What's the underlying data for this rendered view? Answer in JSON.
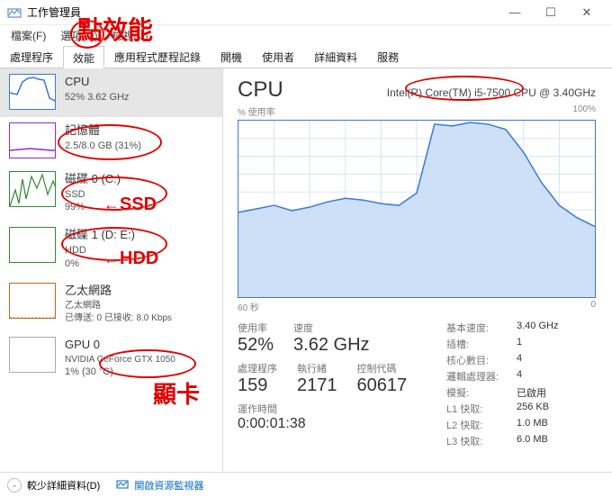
{
  "window": {
    "title": "工作管理員"
  },
  "menu": {
    "file": "檔案(F)",
    "options": "選項(O)",
    "view": "檢視(V)"
  },
  "tabs": [
    "處理程序",
    "效能",
    "應用程式歷程記錄",
    "開機",
    "使用者",
    "詳細資料",
    "服務"
  ],
  "sidebar": [
    {
      "name": "CPU",
      "sub": "52% 3.62 GHz",
      "color": "#3b78d6",
      "type": "cpu"
    },
    {
      "name": "記憶體",
      "sub": "2.5/8.0 GB (31%)",
      "color": "#8a2be2",
      "type": "mem"
    },
    {
      "name": "磁碟 0 (C:)",
      "sub1": "SSD",
      "sub2": "99%",
      "color": "#2e8b2e",
      "type": "disk"
    },
    {
      "name": "磁碟 1 (D: E:)",
      "sub1": "HDD",
      "sub2": "0%",
      "color": "#2e8b2e",
      "type": "disk"
    },
    {
      "name": "乙太網路",
      "sub1": "乙太網路",
      "sub2": "已傳送: 0  已接收: 8.0 Kbps",
      "color": "#b86b1f",
      "type": "net",
      "small": true
    },
    {
      "name": "GPU 0",
      "sub1": "NVIDIA GeForce GTX 1050",
      "sub2": "1% (30 °C)",
      "color": "#888",
      "type": "gpu"
    }
  ],
  "detail": {
    "title": "CPU",
    "model": "Intel(R) Core(TM) i5-7500 CPU @ 3.40GHz",
    "ylabel": "% 使用率",
    "ymax": "100%",
    "xleft": "60 秒",
    "xright": "0"
  },
  "stats_left": {
    "util_label": "使用率",
    "util": "52%",
    "speed_label": "速度",
    "speed": "3.62 GHz",
    "p_label": "處理程序",
    "p": "159",
    "t_label": "執行緒",
    "t": "2171",
    "h_label": "控制代碼",
    "h": "60617",
    "up_label": "運作時間",
    "up": "0:00:01:38"
  },
  "stats_right": [
    {
      "k": "基本速度:",
      "v": "3.40 GHz"
    },
    {
      "k": "插槽:",
      "v": "1"
    },
    {
      "k": "核心數目:",
      "v": "4"
    },
    {
      "k": "邏輯處理器:",
      "v": "4"
    },
    {
      "k": "模擬:",
      "v": "已啟用"
    },
    {
      "k": "L1 快取:",
      "v": "256 KB"
    },
    {
      "k": "L2 快取:",
      "v": "1.0 MB"
    },
    {
      "k": "L3 快取:",
      "v": "6.0 MB"
    }
  ],
  "bottom": {
    "less": "較少詳細資料(D)",
    "link": "開啟資源監視器"
  },
  "annotations": {
    "click_perf": "點效能",
    "ssd": "SSD",
    "hdd": "HDD",
    "gpu": "顯卡"
  },
  "chart_data": {
    "type": "area",
    "title": "CPU % 使用率",
    "xlabel": "秒",
    "ylabel": "% 使用率",
    "ylim": [
      0,
      100
    ],
    "x_seconds": [
      60,
      57,
      54,
      51,
      48,
      45,
      42,
      39,
      36,
      33,
      30,
      27,
      24,
      21,
      18,
      15,
      12,
      9,
      6,
      3,
      0
    ],
    "values": [
      48,
      50,
      52,
      49,
      51,
      54,
      56,
      55,
      53,
      52,
      59,
      98,
      97,
      99,
      98,
      95,
      82,
      65,
      52,
      45,
      40
    ]
  }
}
